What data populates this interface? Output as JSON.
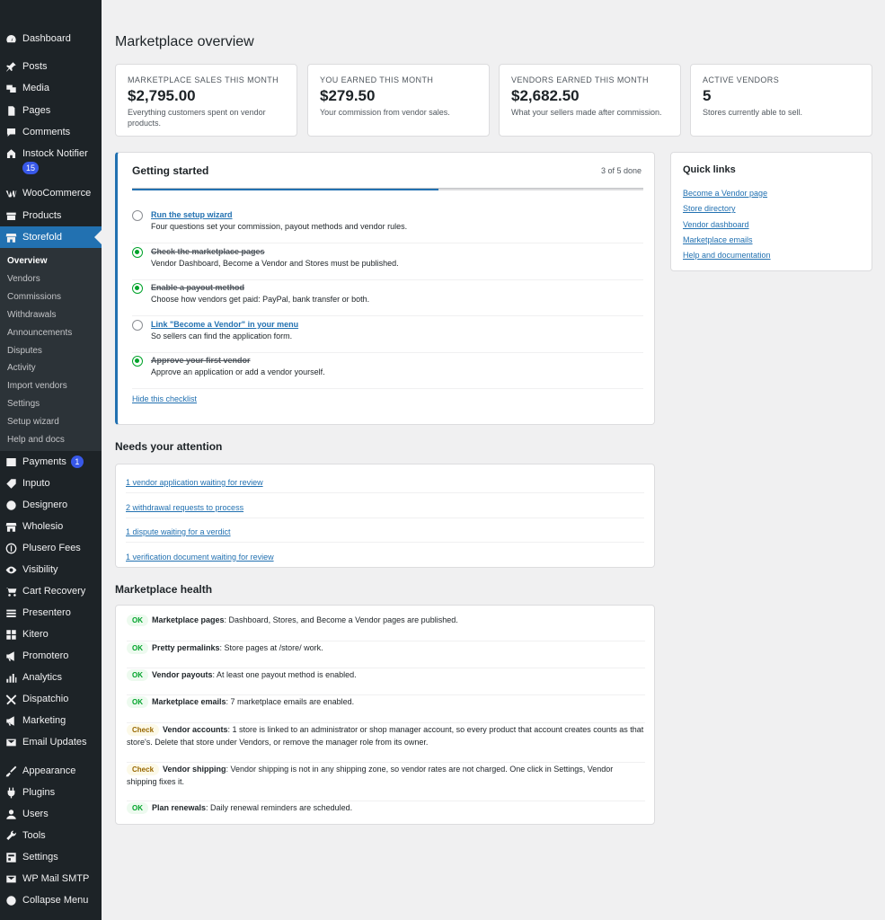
{
  "sidebar": {
    "items": [
      {
        "label": "Dashboard",
        "icon": "dashboard-icon"
      },
      {
        "label": "Posts",
        "icon": "pin-icon"
      },
      {
        "label": "Media",
        "icon": "media-icon"
      },
      {
        "label": "Pages",
        "icon": "pages-icon"
      },
      {
        "label": "Comments",
        "icon": "comments-icon"
      },
      {
        "label": "Instock Notifier",
        "icon": "notifier-icon",
        "badge": "15"
      },
      {
        "label": "WooCommerce",
        "icon": "woocommerce-icon"
      },
      {
        "label": "Products",
        "icon": "products-icon"
      },
      {
        "label": "Storefold",
        "icon": "store-icon"
      },
      {
        "label": "Payments",
        "icon": "payments-icon",
        "badge": "1"
      },
      {
        "label": "Inputo",
        "icon": "tag-icon"
      },
      {
        "label": "Designero",
        "icon": "palette-icon"
      },
      {
        "label": "Wholesio",
        "icon": "store-icon"
      },
      {
        "label": "Plusero Fees",
        "icon": "dollar-icon"
      },
      {
        "label": "Visibility",
        "icon": "eye-icon"
      },
      {
        "label": "Cart Recovery",
        "icon": "cart-icon"
      },
      {
        "label": "Presentero",
        "icon": "stack-icon"
      },
      {
        "label": "Kitero",
        "icon": "grid-icon"
      },
      {
        "label": "Promotero",
        "icon": "megaphone-icon"
      },
      {
        "label": "Analytics",
        "icon": "chart-icon"
      },
      {
        "label": "Dispatchio",
        "icon": "plane-icon"
      },
      {
        "label": "Marketing",
        "icon": "megaphone-icon"
      },
      {
        "label": "Email Updates",
        "icon": "mail-icon"
      },
      {
        "label": "Appearance",
        "icon": "brush-icon"
      },
      {
        "label": "Plugins",
        "icon": "plug-icon"
      },
      {
        "label": "Users",
        "icon": "user-icon"
      },
      {
        "label": "Tools",
        "icon": "wrench-icon"
      },
      {
        "label": "Settings",
        "icon": "settings-icon"
      },
      {
        "label": "WP Mail SMTP",
        "icon": "mail-icon"
      },
      {
        "label": "Collapse Menu",
        "icon": "collapse-icon"
      }
    ],
    "submenu": [
      "Overview",
      "Vendors",
      "Commissions",
      "Withdrawals",
      "Announcements",
      "Disputes",
      "Activity",
      "Import vendors",
      "Settings",
      "Setup wizard",
      "Help and docs"
    ]
  },
  "page": {
    "title": "Marketplace overview"
  },
  "stats": [
    {
      "label": "Marketplace sales this month",
      "value": "$2,795.00",
      "desc": "Everything customers spent on vendor products."
    },
    {
      "label": "You earned this month",
      "value": "$279.50",
      "desc": "Your commission from vendor sales."
    },
    {
      "label": "Vendors earned this month",
      "value": "$2,682.50",
      "desc": "What your sellers made after commission."
    },
    {
      "label": "Active vendors",
      "value": "5",
      "desc": "Stores currently able to sell."
    }
  ],
  "getting_started": {
    "title": "Getting started",
    "count": "3 of 5 done",
    "progress": 0.6,
    "steps": [
      {
        "title": "Run the setup wizard",
        "desc": "Four questions set your commission, payout methods and vendor rules.",
        "done": false
      },
      {
        "title": "Check the marketplace pages",
        "desc": "Vendor Dashboard, Become a Vendor and Stores must be published.",
        "done": true
      },
      {
        "title": "Enable a payout method",
        "desc": "Choose how vendors get paid: PayPal, bank transfer or both.",
        "done": true
      },
      {
        "title": "Link \"Become a Vendor\" in your menu",
        "desc": "So sellers can find the application form.",
        "done": false
      },
      {
        "title": "Approve your first vendor",
        "desc": "Approve an application or add a vendor yourself.",
        "done": true
      }
    ],
    "hide_link": "Hide this checklist"
  },
  "quick_links": {
    "title": "Quick links",
    "links": [
      "Become a Vendor page",
      "Store directory",
      "Vendor dashboard",
      "Marketplace emails",
      "Help and documentation"
    ]
  },
  "attention": {
    "title": "Needs your attention",
    "items": [
      "1 vendor application waiting for review",
      "2 withdrawal requests to process",
      "1 dispute waiting for a verdict",
      "1 verification document waiting for review"
    ]
  },
  "health": {
    "title": "Marketplace health",
    "items": [
      {
        "status": "OK",
        "name": "Marketplace pages",
        "text": ": Dashboard, Stores, and Become a Vendor pages are published."
      },
      {
        "status": "OK",
        "name": "Pretty permalinks",
        "text": ": Store pages at /store/ work."
      },
      {
        "status": "OK",
        "name": "Vendor payouts",
        "text": ": At least one payout method is enabled."
      },
      {
        "status": "OK",
        "name": "Marketplace emails",
        "text": ": 7 marketplace emails are enabled."
      },
      {
        "status": "Check",
        "name": "Vendor accounts",
        "text": ": 1 store is linked to an administrator or shop manager account, so every product that account creates counts as that store's. Delete that store under Vendors, or remove the manager role from its owner."
      },
      {
        "status": "Check",
        "name": "Vendor shipping",
        "text": ": Vendor shipping is not in any shipping zone, so vendor rates are not charged. One click in Settings, Vendor shipping fixes it."
      },
      {
        "status": "OK",
        "name": "Plan renewals",
        "text": ": Daily renewal reminders are scheduled."
      }
    ]
  }
}
